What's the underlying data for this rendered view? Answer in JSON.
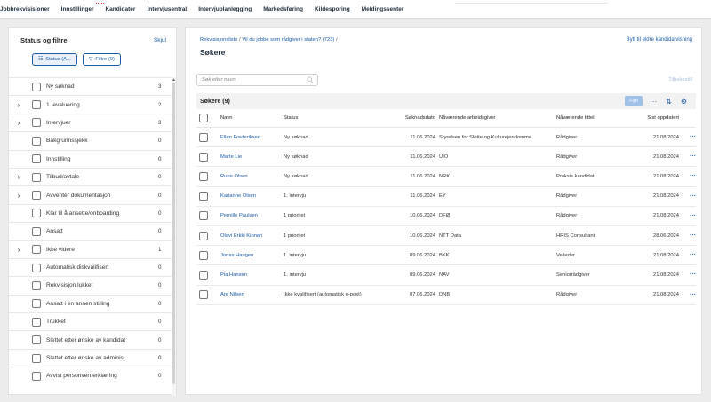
{
  "nav": {
    "items": [
      "Jobbrekvisisjoner",
      "Innstillinger",
      "Kandidater",
      "Intervjusentral",
      "Intervjuplanlegging",
      "Markedsføring",
      "Kildesporing",
      "Meldingssenter"
    ]
  },
  "sidebar": {
    "title": "Status og filtre",
    "hide_label": "Skjul",
    "status_button": "Status (A...",
    "filter_button": "Filtre (0)",
    "items": [
      {
        "label": "Ny søknad",
        "count": "3",
        "expandable": false
      },
      {
        "label": "1. evaluering",
        "count": "2",
        "expandable": true
      },
      {
        "label": "Intervjuer",
        "count": "3",
        "expandable": true
      },
      {
        "label": "Bakgrunnssjekk",
        "count": "0",
        "expandable": false
      },
      {
        "label": "Innstilling",
        "count": "0",
        "expandable": false
      },
      {
        "label": "Tilbud/avtale",
        "count": "0",
        "expandable": true
      },
      {
        "label": "Avventer dokumentasjon",
        "count": "0",
        "expandable": true
      },
      {
        "label": "Klar til å ansette/onboarding",
        "count": "0",
        "expandable": false
      },
      {
        "label": "Ansatt",
        "count": "0",
        "expandable": false
      },
      {
        "label": "Ikke videre",
        "count": "1",
        "expandable": true
      },
      {
        "label": "Automatisk diskvalifisert",
        "count": "0",
        "expandable": false
      },
      {
        "label": "Rekvisisjon lukket",
        "count": "0",
        "expandable": false
      },
      {
        "label": "Ansatt i en annen stilling",
        "count": "0",
        "expandable": false
      },
      {
        "label": "Trukket",
        "count": "0",
        "expandable": false
      },
      {
        "label": "Slettet etter ønske av kandidat",
        "count": "0",
        "expandable": false
      },
      {
        "label": "Slettet etter ønske av adminis...",
        "count": "0",
        "expandable": false
      },
      {
        "label": "Avvist personvernerklæring",
        "count": "0",
        "expandable": false
      }
    ]
  },
  "main": {
    "breadcrumb": {
      "root": "Rekvisisjonsliste",
      "sep": " / ",
      "current": "Vil du jobbe som rådgiver i staten? (723)",
      "trail": " /"
    },
    "title": "Søkere",
    "old_view_link": "Bytt til eldre kandidatvisning",
    "search_placeholder": "Søk etter navn",
    "reset_label": "Tilbakestill",
    "count_title": "Søkere (9)",
    "move_button": "Flytt",
    "columns": [
      "Navn",
      "Status",
      "Søknadsdato",
      "Nåværende arbeidsgiver",
      "Nåværende tittel",
      "Sist oppdatert"
    ],
    "rows": [
      {
        "name": "Ellen Frederiksen",
        "status": "Ny søknad",
        "date": "11.06.2024",
        "employer": "Styrelsen for Slotte og Kulturejendomme",
        "title": "Rådgiver",
        "updated": "21.08.2024"
      },
      {
        "name": "Marte Lie",
        "status": "Ny søknad",
        "date": "11.06.2024",
        "employer": "UIO",
        "title": "Rådgiver",
        "updated": "21.08.2024"
      },
      {
        "name": "Rune Olsen",
        "status": "Ny søknad",
        "date": "11.06.2024",
        "employer": "NRK",
        "title": "Praksis kandidat",
        "updated": "21.08.2024"
      },
      {
        "name": "Karianne Olsen",
        "status": "1. intervju",
        "date": "11.06.2024",
        "employer": "EY",
        "title": "Rådgiver",
        "updated": "21.08.2024"
      },
      {
        "name": "Pernille Paulsen",
        "status": "1 prioritet",
        "date": "10.06.2024",
        "employer": "DFØ",
        "title": "Rådgiver",
        "updated": "21.08.2024"
      },
      {
        "name": "Olavi Erkki Kinnari",
        "status": "1 prioritet",
        "date": "10.06.2024",
        "employer": "NTT Data",
        "title": "HRIS Consultant",
        "updated": "28.06.2024"
      },
      {
        "name": "Jonas Haugen",
        "status": "1. intervju",
        "date": "09.06.2024",
        "employer": "BKK",
        "title": "Veileder",
        "updated": "21.08.2024"
      },
      {
        "name": "Pia Hansen",
        "status": "1. intervju",
        "date": "09.06.2024",
        "employer": "NAV",
        "title": "Seniorrådgiver",
        "updated": "21.08.2024"
      },
      {
        "name": "Are Nilsen",
        "status": "Ikke kvalifisert (automatisk e-post)",
        "date": "07.06.2024",
        "employer": "DNB",
        "title": "Rådgiver",
        "updated": "21.08.2024"
      }
    ]
  },
  "colors": {
    "link": "#1a5ba8",
    "brand_text": "#1c2b3a"
  }
}
